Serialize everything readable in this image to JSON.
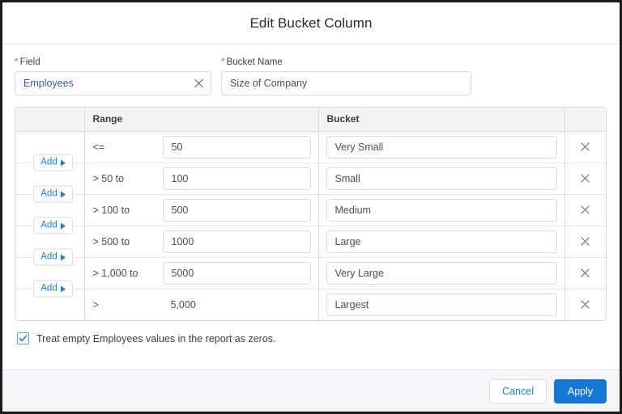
{
  "dialog": {
    "title": "Edit Bucket Column"
  },
  "fields": {
    "field": {
      "label": "Field",
      "required_marker": "*",
      "value": "Employees",
      "placeholder": "",
      "clear_icon": "close-icon"
    },
    "bucket_name": {
      "label": "Bucket Name",
      "required_marker": "*",
      "value": "Size of Company",
      "placeholder": ""
    }
  },
  "table": {
    "headers": {
      "add": "",
      "range": "Range",
      "bucket": "Bucket",
      "delete": ""
    },
    "add_button_label": "Add",
    "add_button_icon": "triangle-right-icon",
    "delete_icon": "close-icon",
    "rows": [
      {
        "operator": "<=",
        "value": "50",
        "value_editable": true,
        "bucket": "Very Small"
      },
      {
        "operator": "> 50 to",
        "value": "100",
        "value_editable": true,
        "bucket": "Small"
      },
      {
        "operator": "> 100 to",
        "value": "500",
        "value_editable": true,
        "bucket": "Medium"
      },
      {
        "operator": "> 500 to",
        "value": "1000",
        "value_editable": true,
        "bucket": "Large"
      },
      {
        "operator": "> 1,000 to",
        "value": "5000",
        "value_editable": true,
        "bucket": "Very Large"
      },
      {
        "operator": ">",
        "value": "5,000",
        "value_editable": false,
        "bucket": "Largest"
      }
    ]
  },
  "options": {
    "treat_empty_as_zeros": {
      "label": "Treat empty Employees values in the report as zeros.",
      "checked": true,
      "icon": "check-icon"
    }
  },
  "footer": {
    "cancel_label": "Cancel",
    "apply_label": "Apply"
  },
  "colors": {
    "accent_blue": "#1478d4",
    "link_blue": "#1b7fd4",
    "required_red": "#e3536b",
    "border_gray": "#dddbda",
    "header_bg": "#f3f3f3",
    "footer_bg": "#f4f6f9"
  }
}
